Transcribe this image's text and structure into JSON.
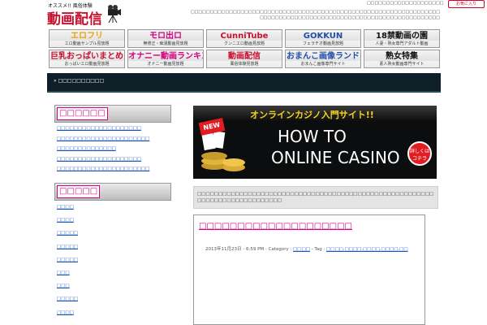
{
  "header": {
    "logo_small": "オススメ!! 風俗体験",
    "logo_big": "動画配信",
    "tagline": "□□□□□□□□□□□□□□□□□□□□",
    "description": "□□□□□□□□□□□□□□□□□□□□□□□□□□□□□□□□□□□□□□□□□□□□□□□□□□□□□□□□□□□□□□□□□□□□□□□□□□□□□□□□□□□□□□□□□□□□□□□□□□□□□□□□□□□□□□□□",
    "bookmark_label": "お気に入り"
  },
  "banners": [
    {
      "title": "エロフリ",
      "sub": "エロ動画サンプル見放題",
      "color": "#e8a200"
    },
    {
      "title": "モロ出ロ",
      "sub": "無修正・痴漢動画見放題",
      "color": "#d40080"
    },
    {
      "title": "CunniTube",
      "sub": "クンニエロ動画見放題",
      "color": "#c8102e"
    },
    {
      "title": "GOKKUN",
      "sub": "フェラチオ動画見放題",
      "color": "#1f4fa8"
    },
    {
      "title": "18禁動画の園",
      "sub": "人妻・熟女専門アダルト動画",
      "color": "#111111"
    },
    {
      "title": "巨乳おっぱいまとめ",
      "sub": "おっぱいエロ動画見放題",
      "color": "#c8102e"
    },
    {
      "title": "オナニー動画ランキング",
      "sub": "オナニー動画見放題",
      "color": "#d40080"
    },
    {
      "title": "動画配信",
      "sub": "風俗体験見放題",
      "color": "#c8102e"
    },
    {
      "title": "おまんこ画像ランド",
      "sub": "おまんこ画像専門サイト",
      "color": "#1f4fa8"
    },
    {
      "title": "熟女特集",
      "sub": "素人熟女動画専門サイト",
      "color": "#111111"
    }
  ],
  "nav": {
    "breadcrumb": "» □□□□□□□□□□"
  },
  "sidebar": {
    "section1_title": "□□□□□□",
    "section1_links": [
      "□□□□□□□□□□□□□□□□□□□□",
      "□□□□□□□□□□□□□□□□□□□□□□",
      "□□□□□□□□□□□□□□",
      "□□□□□□□□□□□□□□□□□□□□",
      "□□□□□□□□□□□□□□□□□□□□□□"
    ],
    "section2_title": "□□□□□",
    "section2_links": [
      "□□□□",
      "□□□□",
      "□□□□□",
      "□□□□□",
      "□□□□□",
      "□□□",
      "□□□",
      "□□□□□",
      "□□□□"
    ]
  },
  "casino": {
    "top": "オンラインカジノ入門サイト!!",
    "line1": "HOW TO",
    "line2": "ONLINE CASINO",
    "new": "NEW",
    "cta": "詳しくはコチラ"
  },
  "info_text": "□□□□□□□□□□□□□□□□□□□□□□□□□□□□□□□□□□□□□□□□□□□□□□□□□□□□□□□□□□□□□□□□□□□□□□□□□□□□",
  "article": {
    "title": "□□□□□□□□□□□□□□□□□□□□",
    "date": "2013年11月23日 - 6:59 PM - Category :",
    "category": "□□□□",
    "tag_label": "- Tag :",
    "tags": "□□□□,□□□□,□□□□,□□□□,□□"
  }
}
